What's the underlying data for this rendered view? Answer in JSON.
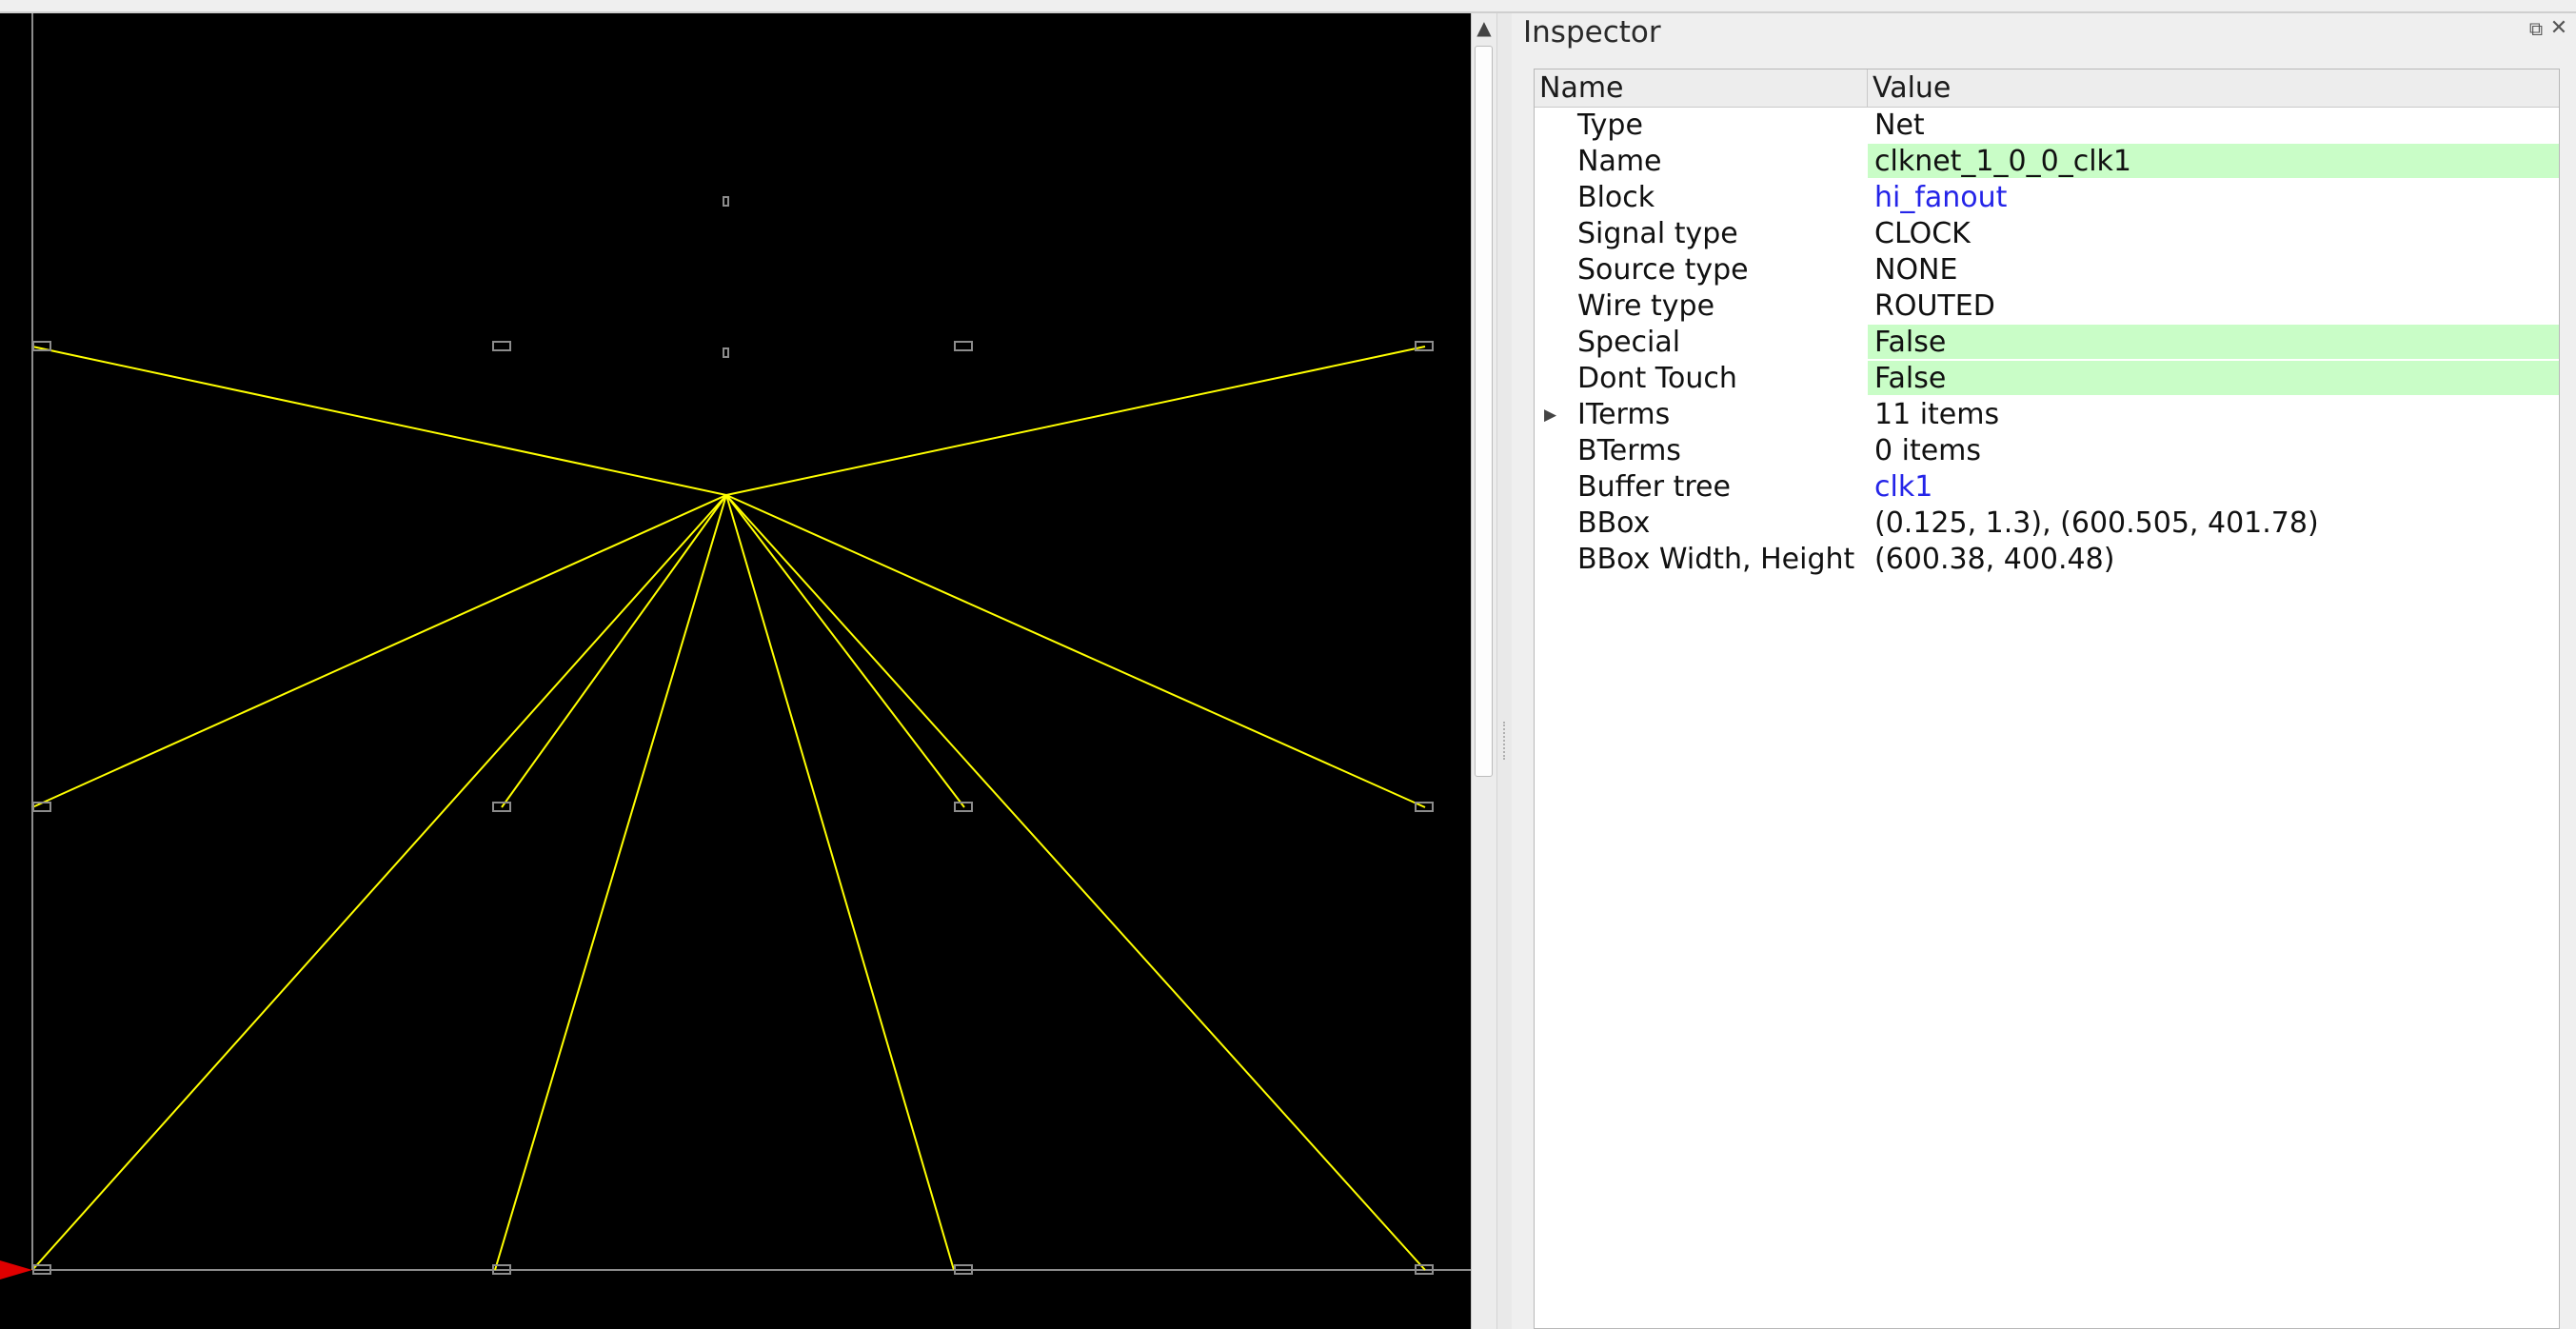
{
  "inspector": {
    "title": "Inspector",
    "float_icon": "⧉",
    "close_icon": "✕",
    "columns": {
      "name": "Name",
      "value": "Value"
    },
    "rows": [
      {
        "name": "Type",
        "value": "Net",
        "style": "plain",
        "expandable": false
      },
      {
        "name": "Name",
        "value": "clknet_1_0_0_clk1",
        "style": "edit",
        "expandable": false
      },
      {
        "name": "Block",
        "value": "hi_fanout",
        "style": "link",
        "expandable": false
      },
      {
        "name": "Signal type",
        "value": "CLOCK",
        "style": "plain",
        "expandable": false
      },
      {
        "name": "Source type",
        "value": "NONE",
        "style": "plain",
        "expandable": false
      },
      {
        "name": "Wire type",
        "value": "ROUTED",
        "style": "plain",
        "expandable": false
      },
      {
        "name": "Special",
        "value": "False",
        "style": "edit",
        "expandable": false
      },
      {
        "name": "Dont Touch",
        "value": "False",
        "style": "edit",
        "expandable": false
      },
      {
        "name": "ITerms",
        "value": "11 items",
        "style": "plain",
        "expandable": true
      },
      {
        "name": "BTerms",
        "value": "0 items",
        "style": "plain",
        "expandable": false
      },
      {
        "name": "Buffer tree",
        "value": "clk1",
        "style": "link",
        "expandable": false
      },
      {
        "name": "BBox",
        "value": "(0.125, 1.3), (600.505, 401.78)",
        "style": "plain",
        "expandable": false
      },
      {
        "name": "BBox Width, Height",
        "value": "(600.38, 400.48)",
        "style": "plain",
        "expandable": false
      }
    ]
  },
  "layout": {
    "background": "#000000",
    "net_color": "#ffff00",
    "pin_color": "#8c8c8c",
    "die_edge_color": "#8c8c8c",
    "port_marker_color": "#e00000"
  },
  "scrollbar": {
    "up_icon": "▲"
  }
}
